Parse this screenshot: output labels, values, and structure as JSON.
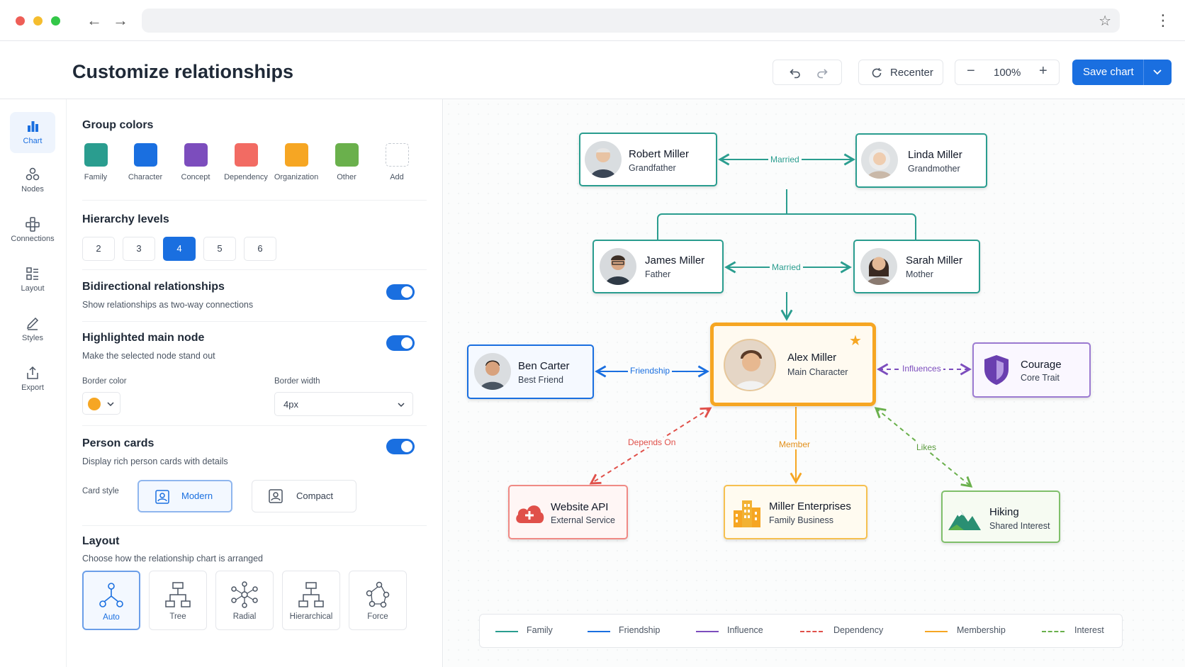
{
  "page": {
    "title": "Customize relationships"
  },
  "toolbar": {
    "undo_icon": "undo-icon",
    "redo_icon": "redo-icon",
    "recenter_label": "Recenter",
    "zoom_value": "100%",
    "save_label": "Save chart"
  },
  "rail": {
    "items": [
      {
        "label": "Chart",
        "icon": "bar-chart-icon",
        "active": true
      },
      {
        "label": "Nodes",
        "icon": "nodes-icon"
      },
      {
        "label": "Connections",
        "icon": "connections-icon"
      },
      {
        "label": "Layout",
        "icon": "layout-icon"
      },
      {
        "label": "Styles",
        "icon": "pen-icon"
      },
      {
        "label": "Export",
        "icon": "export-icon"
      }
    ]
  },
  "panel": {
    "group_colors": {
      "title": "Group colors",
      "swatches": [
        {
          "label": "Family",
          "color": "#2a9d8f"
        },
        {
          "label": "Character",
          "color": "#1a6fe0"
        },
        {
          "label": "Concept",
          "color": "#7c4dbd"
        },
        {
          "label": "Dependency",
          "color": "#f26b63"
        },
        {
          "label": "Organization",
          "color": "#f6a623"
        },
        {
          "label": "Other",
          "color": "#6ab04c"
        },
        {
          "label": "Add",
          "color": ""
        }
      ]
    },
    "hierarchy": {
      "title": "Hierarchy levels",
      "levels": [
        "2",
        "3",
        "4",
        "5",
        "6"
      ],
      "selected": "4"
    },
    "bidirectional": {
      "title": "Bidirectional relationships",
      "desc": "Show relationships as two-way connections",
      "on": true
    },
    "highlighted": {
      "title": "Highlighted main node",
      "desc": "Make the selected node stand out",
      "on": true,
      "border_color_label": "Border color",
      "border_color": "#f6a623",
      "border_width_label": "Border width",
      "border_width_value": "4px"
    },
    "person_cards": {
      "title": "Person cards",
      "desc": "Display rich person cards with details",
      "on": true,
      "card_style_label": "Card style",
      "styles": [
        "Modern",
        "Compact"
      ],
      "selected": "Modern"
    },
    "layout": {
      "title": "Layout",
      "desc": "Choose how the relationship chart is arranged",
      "options": [
        "Auto",
        "Tree",
        "Radial",
        "Hierarchical",
        "Force"
      ],
      "selected": "Auto"
    }
  },
  "graph": {
    "nodes": {
      "robert": {
        "name": "Robert Miller",
        "role": "Grandfather"
      },
      "linda": {
        "name": "Linda Miller",
        "role": "Grandmother"
      },
      "james": {
        "name": "James Miller",
        "role": "Father"
      },
      "sarah": {
        "name": "Sarah Miller",
        "role": "Mother"
      },
      "alex": {
        "name": "Alex Miller",
        "role": "Main Character"
      },
      "ben": {
        "name": "Ben Carter",
        "role": "Best Friend"
      },
      "courage": {
        "name": "Courage",
        "role": "Core Trait"
      },
      "website": {
        "name": "Website API",
        "role": "External Service"
      },
      "enterprises": {
        "name": "Miller Enterprises",
        "role": "Family Business"
      },
      "hiking": {
        "name": "Hiking",
        "role": "Shared Interest"
      }
    },
    "edges": {
      "married_top": "Married",
      "married_mid": "Married",
      "friendship": "Friendship",
      "influences": "Influences",
      "depends_on": "Depends On",
      "member": "Member",
      "likes": "Likes"
    }
  },
  "legend": [
    {
      "label": "Family",
      "color": "#2a9d8f",
      "dashed": false
    },
    {
      "label": "Friendship",
      "color": "#1a6fe0",
      "dashed": false
    },
    {
      "label": "Influence",
      "color": "#7c4dbd",
      "dashed": false
    },
    {
      "label": "Dependency",
      "color": "#e0504a",
      "dashed": true
    },
    {
      "label": "Membership",
      "color": "#f6a623",
      "dashed": false
    },
    {
      "label": "Interest",
      "color": "#6ab04c",
      "dashed": true
    }
  ]
}
